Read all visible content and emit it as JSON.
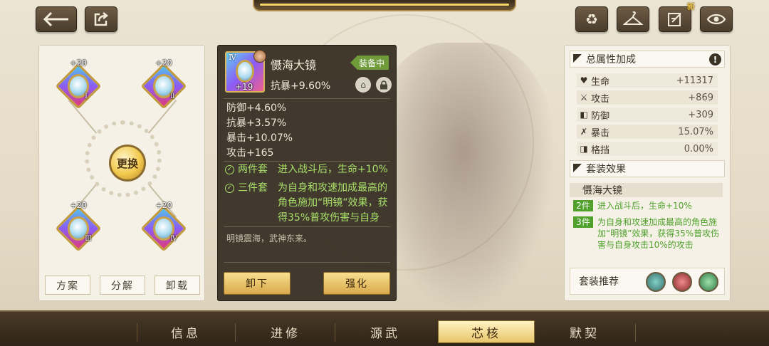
{
  "toolbar": {
    "back_icon": "arrow-left-icon",
    "share_icon": "share-icon",
    "recycle_icon": "recycle-icon",
    "outfit_icon": "hanger-icon",
    "edit_icon": "edit-icon",
    "edit_badge": "新",
    "view_icon": "eye-icon"
  },
  "slots": {
    "center_label": "更换",
    "items": [
      {
        "level": "+20",
        "roman": "Ⅰ"
      },
      {
        "level": "+20",
        "roman": "Ⅱ"
      },
      {
        "level": "+20",
        "roman": "Ⅲ"
      },
      {
        "level": "+20",
        "roman": "Ⅳ"
      }
    ],
    "buttons": [
      "方案",
      "分解",
      "卸载"
    ]
  },
  "detail": {
    "roman": "Ⅳ",
    "level": "+19",
    "name": "慑海大镜",
    "main_stat": "抗暴+9.60%",
    "equipped": "装备中",
    "sub_stats": [
      "防御+4.60%",
      "抗暴+3.57%",
      "暴击+10.07%",
      "攻击+165"
    ],
    "set_bonuses": [
      {
        "label": "两件套",
        "text": "进入战斗后，生命+10%"
      },
      {
        "label": "三件套",
        "text": "为自身和攻速加成最高的角色施加“明镜”效果，获得35%普攻伤害与自身"
      }
    ],
    "flavor": "明镜震海，武神东来。",
    "unequip_label": "卸下",
    "enhance_label": "强化"
  },
  "totals": {
    "title": "总属性加成",
    "stats": [
      {
        "icon": "♥",
        "name": "生命",
        "value": "+11317"
      },
      {
        "icon": "⚔",
        "name": "攻击",
        "value": "+869"
      },
      {
        "icon": "◧",
        "name": "防御",
        "value": "+309"
      },
      {
        "icon": "✗",
        "name": "暴击",
        "value": "15.07%"
      },
      {
        "icon": "◨",
        "name": "格挡",
        "value": "0.00%"
      }
    ]
  },
  "set_effect": {
    "title": "套装效果",
    "set_name": "慑海大镜",
    "effects": [
      {
        "count": "2件",
        "text": "进入战斗后，生命+10%"
      },
      {
        "count": "3件",
        "text": "为自身和攻速加成最高的角色施加“明镜”效果，获得35%普攻伤害与自身攻击10%的攻击"
      }
    ],
    "recommend_label": "套装推荐"
  },
  "tabs": [
    "信息",
    "进修",
    "源武",
    "芯核",
    "默契"
  ],
  "active_tab": "芯核"
}
